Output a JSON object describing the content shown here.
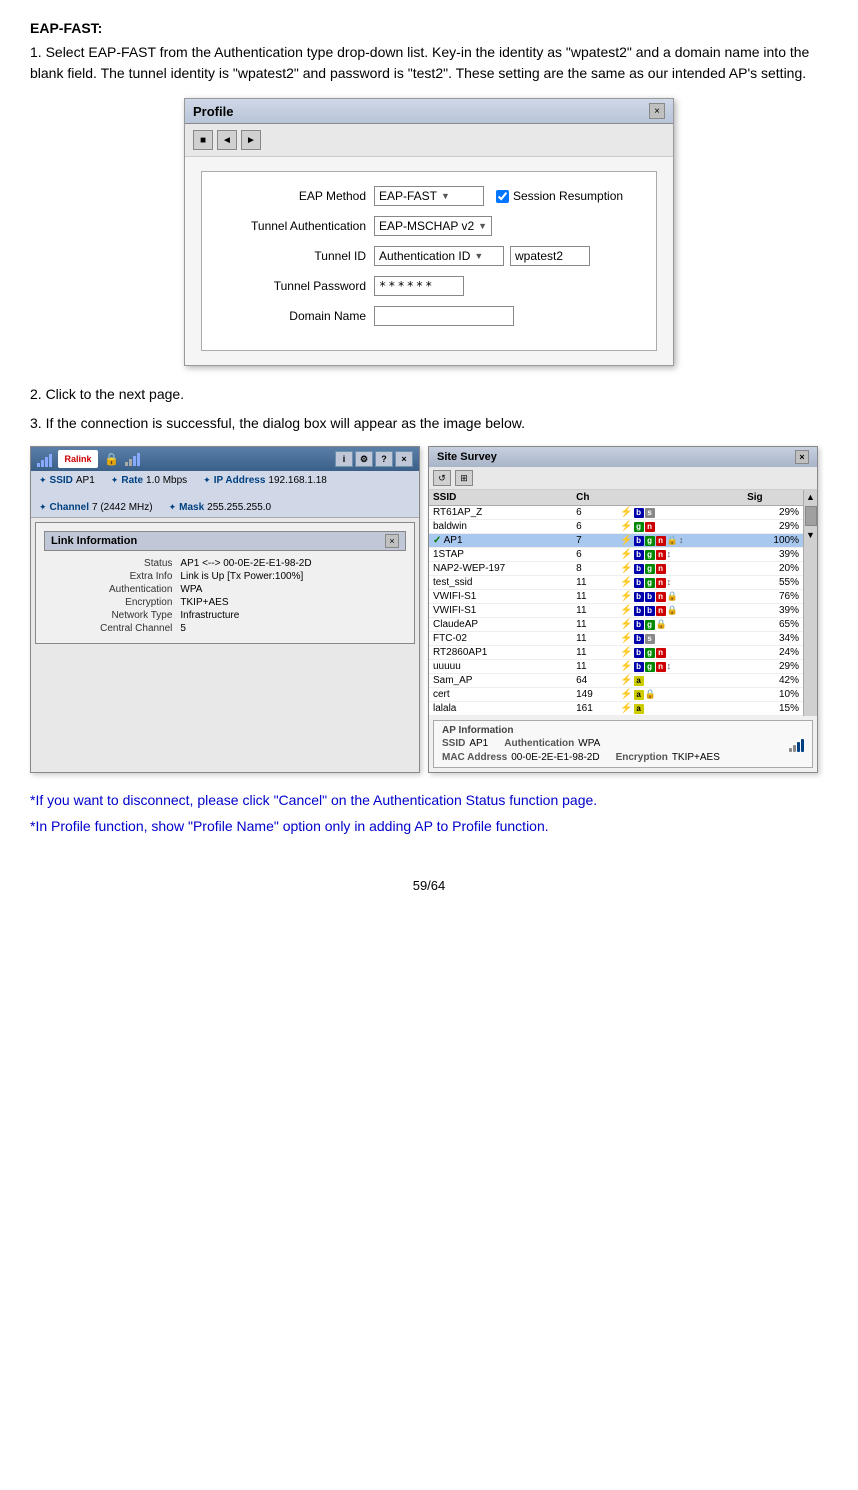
{
  "title": "EAP-FAST:",
  "intro_paragraphs": [
    "1. Select EAP-FAST from the Authentication type drop-down list. Key-in the identity as \"wpatest2\" and a domain name into the blank field. The tunnel identity is \"wpatest2\" and password is \"test2\". These setting are the same as our intended AP's setting."
  ],
  "profile_dialog": {
    "title": "Profile",
    "close_btn": "×",
    "toolbar_buttons": [
      "■",
      "◄",
      "►"
    ],
    "fields": [
      {
        "label": "EAP Method",
        "type": "dropdown",
        "value": "EAP-FAST",
        "extra": {
          "checkbox": true,
          "checkbox_label": "Session Resumption"
        }
      },
      {
        "label": "Tunnel Authentication",
        "type": "dropdown",
        "value": "EAP-MSCHAP v2"
      },
      {
        "label": "Tunnel ID",
        "type": "dropdown+text",
        "dropdown_value": "Authentication ID",
        "text_value": "wpatest2"
      },
      {
        "label": "Tunnel Password",
        "type": "password",
        "value": "******"
      },
      {
        "label": "Domain Name",
        "type": "text",
        "value": ""
      }
    ]
  },
  "steps": [
    "2. Click to the next page.",
    "3. If the connection is successful, the dialog box will appear as the image below."
  ],
  "ralink_window": {
    "logo": "Ralink",
    "ssid_label": "SSID",
    "ssid_value": "AP1",
    "rate_label": "Rate",
    "rate_value": "1.0 Mbps",
    "ip_label": "IP Address",
    "ip_value": "192.168.1.18",
    "channel_label": "Channel",
    "channel_value": "7 (2442 MHz)",
    "mask_label": "Mask",
    "mask_value": "255.255.255.0",
    "link_info": {
      "title": "Link Information",
      "rows": [
        {
          "key": "Status",
          "value": "AP1 <--> 00-0E-2E-E1-98-2D"
        },
        {
          "key": "Extra Info",
          "value": "Link is Up [Tx Power:100%]"
        },
        {
          "key": "Authentication",
          "value": "WPA"
        },
        {
          "key": "Encryption",
          "value": "TKIP+AES"
        },
        {
          "key": "Network Type",
          "value": "Infrastructure"
        },
        {
          "key": "Central Channel",
          "value": "5"
        }
      ]
    }
  },
  "site_survey": {
    "title": "Site Survey",
    "close_btn": "×",
    "columns": [
      "SSID",
      "Ch",
      "",
      "Sig"
    ],
    "rows": [
      {
        "ssid": "RT61AP_Z",
        "ch": "6",
        "badges": "bs",
        "sig": "29%",
        "selected": false
      },
      {
        "ssid": "baldwin",
        "ch": "6",
        "badges": "gn",
        "sig": "29%",
        "selected": false
      },
      {
        "ssid": "AP1",
        "ch": "7",
        "badges": "bgn",
        "sig": "100%",
        "selected": true
      },
      {
        "ssid": "1STAP",
        "ch": "6",
        "badges": "bgn",
        "sig": "39%",
        "selected": false
      },
      {
        "ssid": "NAP2-WEP-197",
        "ch": "8",
        "badges": "bgn",
        "sig": "20%",
        "selected": false
      },
      {
        "ssid": "test_ssid",
        "ch": "11",
        "badges": "bgn",
        "sig": "55%",
        "selected": false
      },
      {
        "ssid": "VWIFI-S1",
        "ch": "11",
        "badges": "bbn",
        "sig": "76%",
        "selected": false
      },
      {
        "ssid": "VWIFI-S1",
        "ch": "11",
        "badges": "bbn",
        "sig": "39%",
        "selected": false
      },
      {
        "ssid": "ClaudeAP",
        "ch": "11",
        "badges": "bg",
        "sig": "65%",
        "selected": false
      },
      {
        "ssid": "FTC-02",
        "ch": "11",
        "badges": "bs",
        "sig": "34%",
        "selected": false
      },
      {
        "ssid": "RT2860AP1",
        "ch": "11",
        "badges": "bgn",
        "sig": "24%",
        "selected": false
      },
      {
        "ssid": "uuuuu",
        "ch": "11",
        "badges": "bgn",
        "sig": "29%",
        "selected": false
      },
      {
        "ssid": "Sam_AP",
        "ch": "64",
        "badges": "a",
        "sig": "42%",
        "selected": false
      },
      {
        "ssid": "cert",
        "ch": "149",
        "badges": "a",
        "sig": "10%",
        "selected": false
      },
      {
        "ssid": "lalala",
        "ch": "161",
        "badges": "a",
        "sig": "15%",
        "selected": false
      }
    ],
    "ap_info": {
      "title": "AP Information",
      "ssid_label": "SSID",
      "ssid_value": "AP1",
      "auth_label": "Authentication",
      "auth_value": "WPA",
      "mac_label": "MAC Address",
      "mac_value": "00-0E-2E-E1-98-2D",
      "enc_label": "Encryption",
      "enc_value": "TKIP+AES"
    }
  },
  "notes": [
    "*If you want to disconnect, please click \"Cancel\" on the Authentication Status function page.",
    "*In Profile function, show \"Profile Name\" option only in adding AP to Profile function."
  ],
  "page_number": "59/64"
}
